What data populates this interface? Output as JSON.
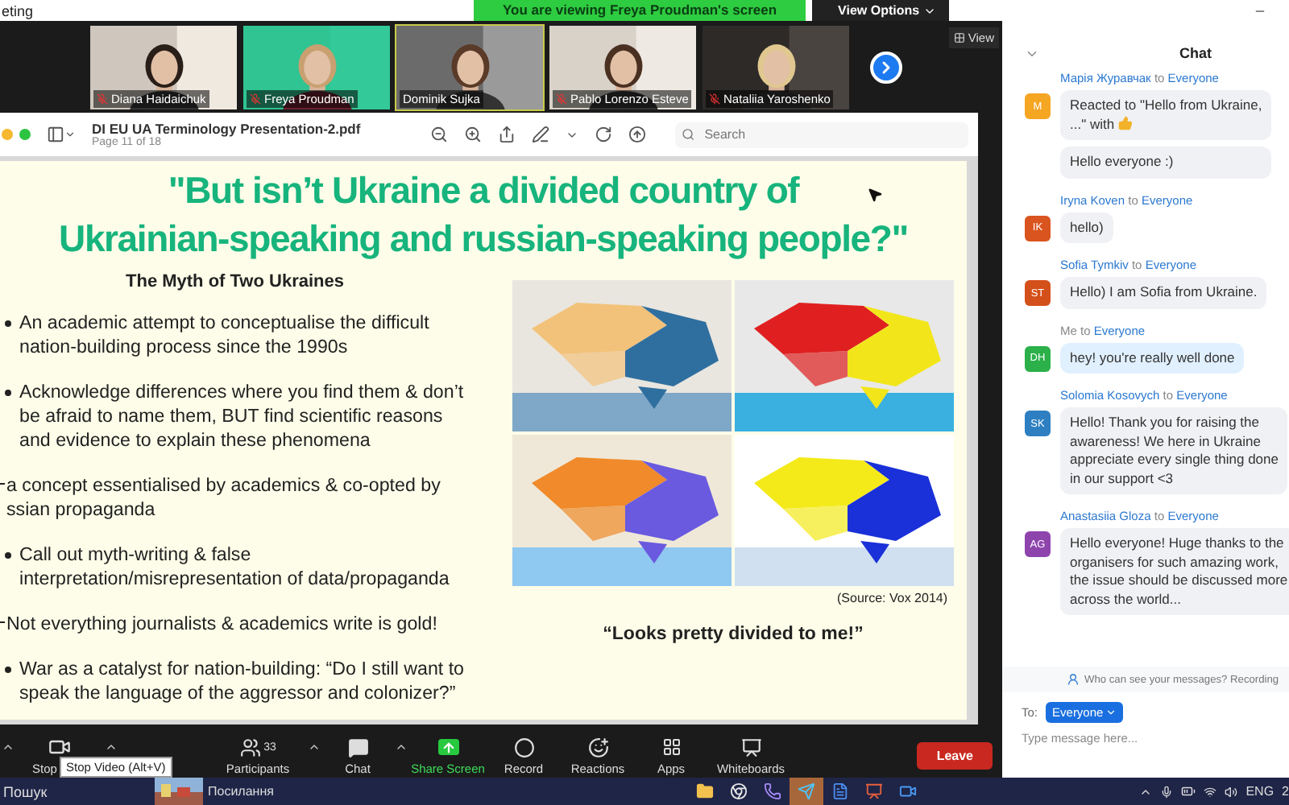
{
  "window": {
    "title": "eting"
  },
  "share_banner": {
    "text": "You are viewing Freya Proudman's screen",
    "options": "View Options"
  },
  "view_button": "View",
  "participants": [
    {
      "name": "Diana Haidaichuk",
      "muted": true,
      "speaking": false
    },
    {
      "name": "Freya Proudman",
      "muted": true,
      "speaking": false
    },
    {
      "name": "Dominik Sujka",
      "muted": false,
      "speaking": true
    },
    {
      "name": "Pablo Lorenzo Esteve",
      "muted": true,
      "speaking": false
    },
    {
      "name": "Nataliia Yaroshenko",
      "muted": true,
      "speaking": false
    }
  ],
  "pdf": {
    "title": "DI EU UA Terminology Presentation-2.pdf",
    "page": "Page 11 of 18",
    "search": {
      "placeholder": "Search"
    }
  },
  "slide": {
    "title": [
      "\"But isn’t Ukraine a divided country of",
      "Ukrainian-speaking and russian-speaking people?\""
    ],
    "subtitle": "The Myth of Two Ukraines",
    "points": [
      {
        "kind": "bullet",
        "lines": [
          "An academic attempt to conceptualise the difficult",
          "nation-building process since the 1990s"
        ]
      },
      {
        "kind": "bullet",
        "lines": [
          "Acknowledge differences where you find them & don’t",
          "be afraid to name them, BUT find scientific reasons",
          "and evidence to explain these phenomena"
        ]
      },
      {
        "kind": "dash",
        "lines": [
          "a concept essentialised by academics & co-opted by",
          "ssian propaganda"
        ]
      },
      {
        "kind": "bullet",
        "lines": [
          "Call out myth-writing & false",
          "interpretation/misrepresentation of data/propaganda"
        ]
      },
      {
        "kind": "dash",
        "lines": [
          "Not everything journalists & academics write is gold!"
        ]
      },
      {
        "kind": "bullet",
        "lines": [
          "War as a catalyst for nation-building: “Do I still want to",
          "speak the language of the aggressor and colonizer?”"
        ]
      }
    ],
    "maps": [
      {
        "kind": "picture"
      },
      {
        "kind": "picture"
      },
      {
        "kind": "picture"
      },
      {
        "kind": "picture"
      }
    ],
    "source": "(Source: Vox 2014)",
    "quote": "“Looks pretty divided to me!”"
  },
  "chat": {
    "title": "Chat",
    "messages": [
      {
        "sender": "Марія Журавчак",
        "connector": "to",
        "to": "Everyone",
        "initials": "M",
        "color": "#f5a623",
        "mine": false,
        "bubbles": [
          {
            "kind": "reaction",
            "lines": [
              "Reacted to \"Hello from Ukraine,",
              "...\" with"
            ]
          },
          {
            "kind": "text",
            "lines": [
              "Hello everyone :)"
            ]
          }
        ]
      },
      {
        "sender": "Iryna Koven",
        "connector": "to",
        "to": "Everyone",
        "initials": "IK",
        "color": "#d9541e",
        "mine": false,
        "bubbles": [
          {
            "kind": "text",
            "lines": [
              "hello)"
            ]
          }
        ]
      },
      {
        "sender": "Sofia Tymkiv",
        "connector": "to",
        "to": "Everyone",
        "initials": "ST",
        "color": "#d4501a",
        "mine": false,
        "bubbles": [
          {
            "kind": "text",
            "lines": [
              "Hello) I am Sofia from Ukraine."
            ]
          }
        ]
      },
      {
        "sender": "Me",
        "connector": "to",
        "to": "Everyone",
        "initials": "DH",
        "color": "#2bb04a",
        "mine": true,
        "bubbles": [
          {
            "kind": "text",
            "lines": [
              "hey! you're really well done"
            ]
          }
        ]
      },
      {
        "sender": "Solomia Kosovych",
        "connector": "to",
        "to": "Everyone",
        "initials": "SK",
        "color": "#2d7fc1",
        "mine": false,
        "bubbles": [
          {
            "kind": "text",
            "lines": [
              "Hello! Thank you for raising the",
              "awareness! We here in Ukraine",
              "appreciate every single thing done",
              "in our support <3"
            ]
          }
        ]
      },
      {
        "sender": "Anastasiia Gloza",
        "connector": "to",
        "to": "Everyone",
        "initials": "AG",
        "color": "#8e44ad",
        "mine": false,
        "bubbles": [
          {
            "kind": "text",
            "lines": [
              "Hello everyone! Huge thanks to the",
              "organisers for such amazing work,",
              "the issue should be discussed more",
              "across the world..."
            ]
          }
        ]
      }
    ],
    "notice": "Who can see your messages? Recording",
    "to_label": "To:",
    "recipient": "Everyone",
    "placeholder": "Type message here..."
  },
  "toolbar": {
    "items": [
      {
        "kind": "video",
        "label": "Stop",
        "caret": true
      },
      {
        "kind": "participants",
        "label": "Participants",
        "count": "33",
        "caret": true
      },
      {
        "kind": "chat",
        "label": "Chat",
        "caret": true
      },
      {
        "kind": "share",
        "label": "Share Screen"
      },
      {
        "kind": "record",
        "label": "Record"
      },
      {
        "kind": "reactions",
        "label": "Reactions"
      },
      {
        "kind": "apps",
        "label": "Apps"
      },
      {
        "kind": "whiteboards",
        "label": "Whiteboards"
      }
    ],
    "leave": "Leave",
    "tooltip": "Stop Video (Alt+V)"
  },
  "taskbar": {
    "search": "Пошук",
    "pinned": "Посилання",
    "apps": [
      {
        "kind": "folder",
        "selected": false
      },
      {
        "kind": "chrome",
        "selected": false
      },
      {
        "kind": "viber",
        "selected": false
      },
      {
        "kind": "telegram",
        "selected": true
      },
      {
        "kind": "word",
        "selected": false
      },
      {
        "kind": "powerpoint",
        "selected": false
      },
      {
        "kind": "zoom",
        "selected": false
      }
    ],
    "language": "ENG",
    "clock": "2"
  }
}
